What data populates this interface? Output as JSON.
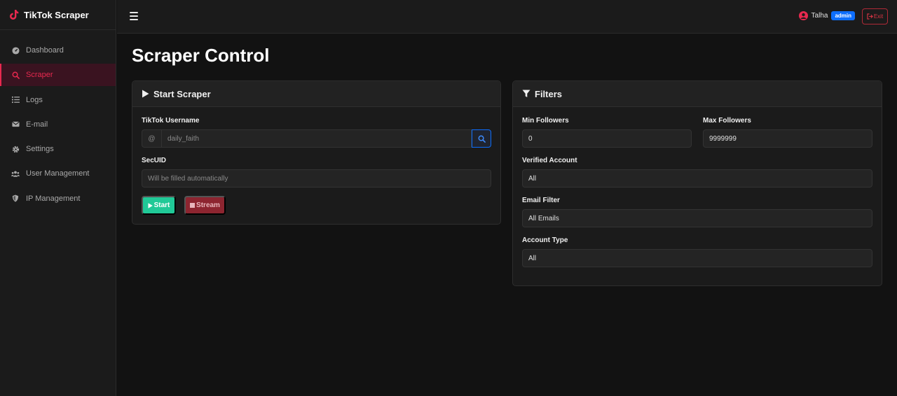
{
  "app": {
    "title": "TikTok Scraper"
  },
  "sidebar": {
    "items": [
      {
        "label": "Dashboard",
        "icon": "dashboard-icon"
      },
      {
        "label": "Scraper",
        "icon": "search-icon",
        "active": true
      },
      {
        "label": "Logs",
        "icon": "list-icon"
      },
      {
        "label": "E-mail",
        "icon": "envelope-icon"
      },
      {
        "label": "Settings",
        "icon": "gear-icon"
      },
      {
        "label": "User Management",
        "icon": "users-icon"
      },
      {
        "label": "IP Management",
        "icon": "shield-icon"
      }
    ]
  },
  "topbar": {
    "user_name": "Talha",
    "user_role": "admin",
    "exit_label": "Exit"
  },
  "page": {
    "title": "Scraper Control"
  },
  "scraper_card": {
    "title": "Start Scraper",
    "username_label": "TikTok Username",
    "username_prefix": "@",
    "username_value": "daily_faith",
    "secuid_label": "SecUID",
    "secuid_placeholder": "Will be filled automatically",
    "start_label": "Start",
    "stream_label": "Stream"
  },
  "filters_card": {
    "title": "Filters",
    "min_followers_label": "Min Followers",
    "min_followers_value": "0",
    "max_followers_label": "Max Followers",
    "max_followers_value": "9999999",
    "verified_label": "Verified Account",
    "verified_value": "All",
    "email_filter_label": "Email Filter",
    "email_filter_value": "All Emails",
    "account_type_label": "Account Type",
    "account_type_value": "All"
  },
  "colors": {
    "accent": "#e8294f",
    "start_button": "#20c997",
    "stream_button": "#8d2530",
    "admin_badge": "#0d6efd",
    "background": "#121212"
  }
}
